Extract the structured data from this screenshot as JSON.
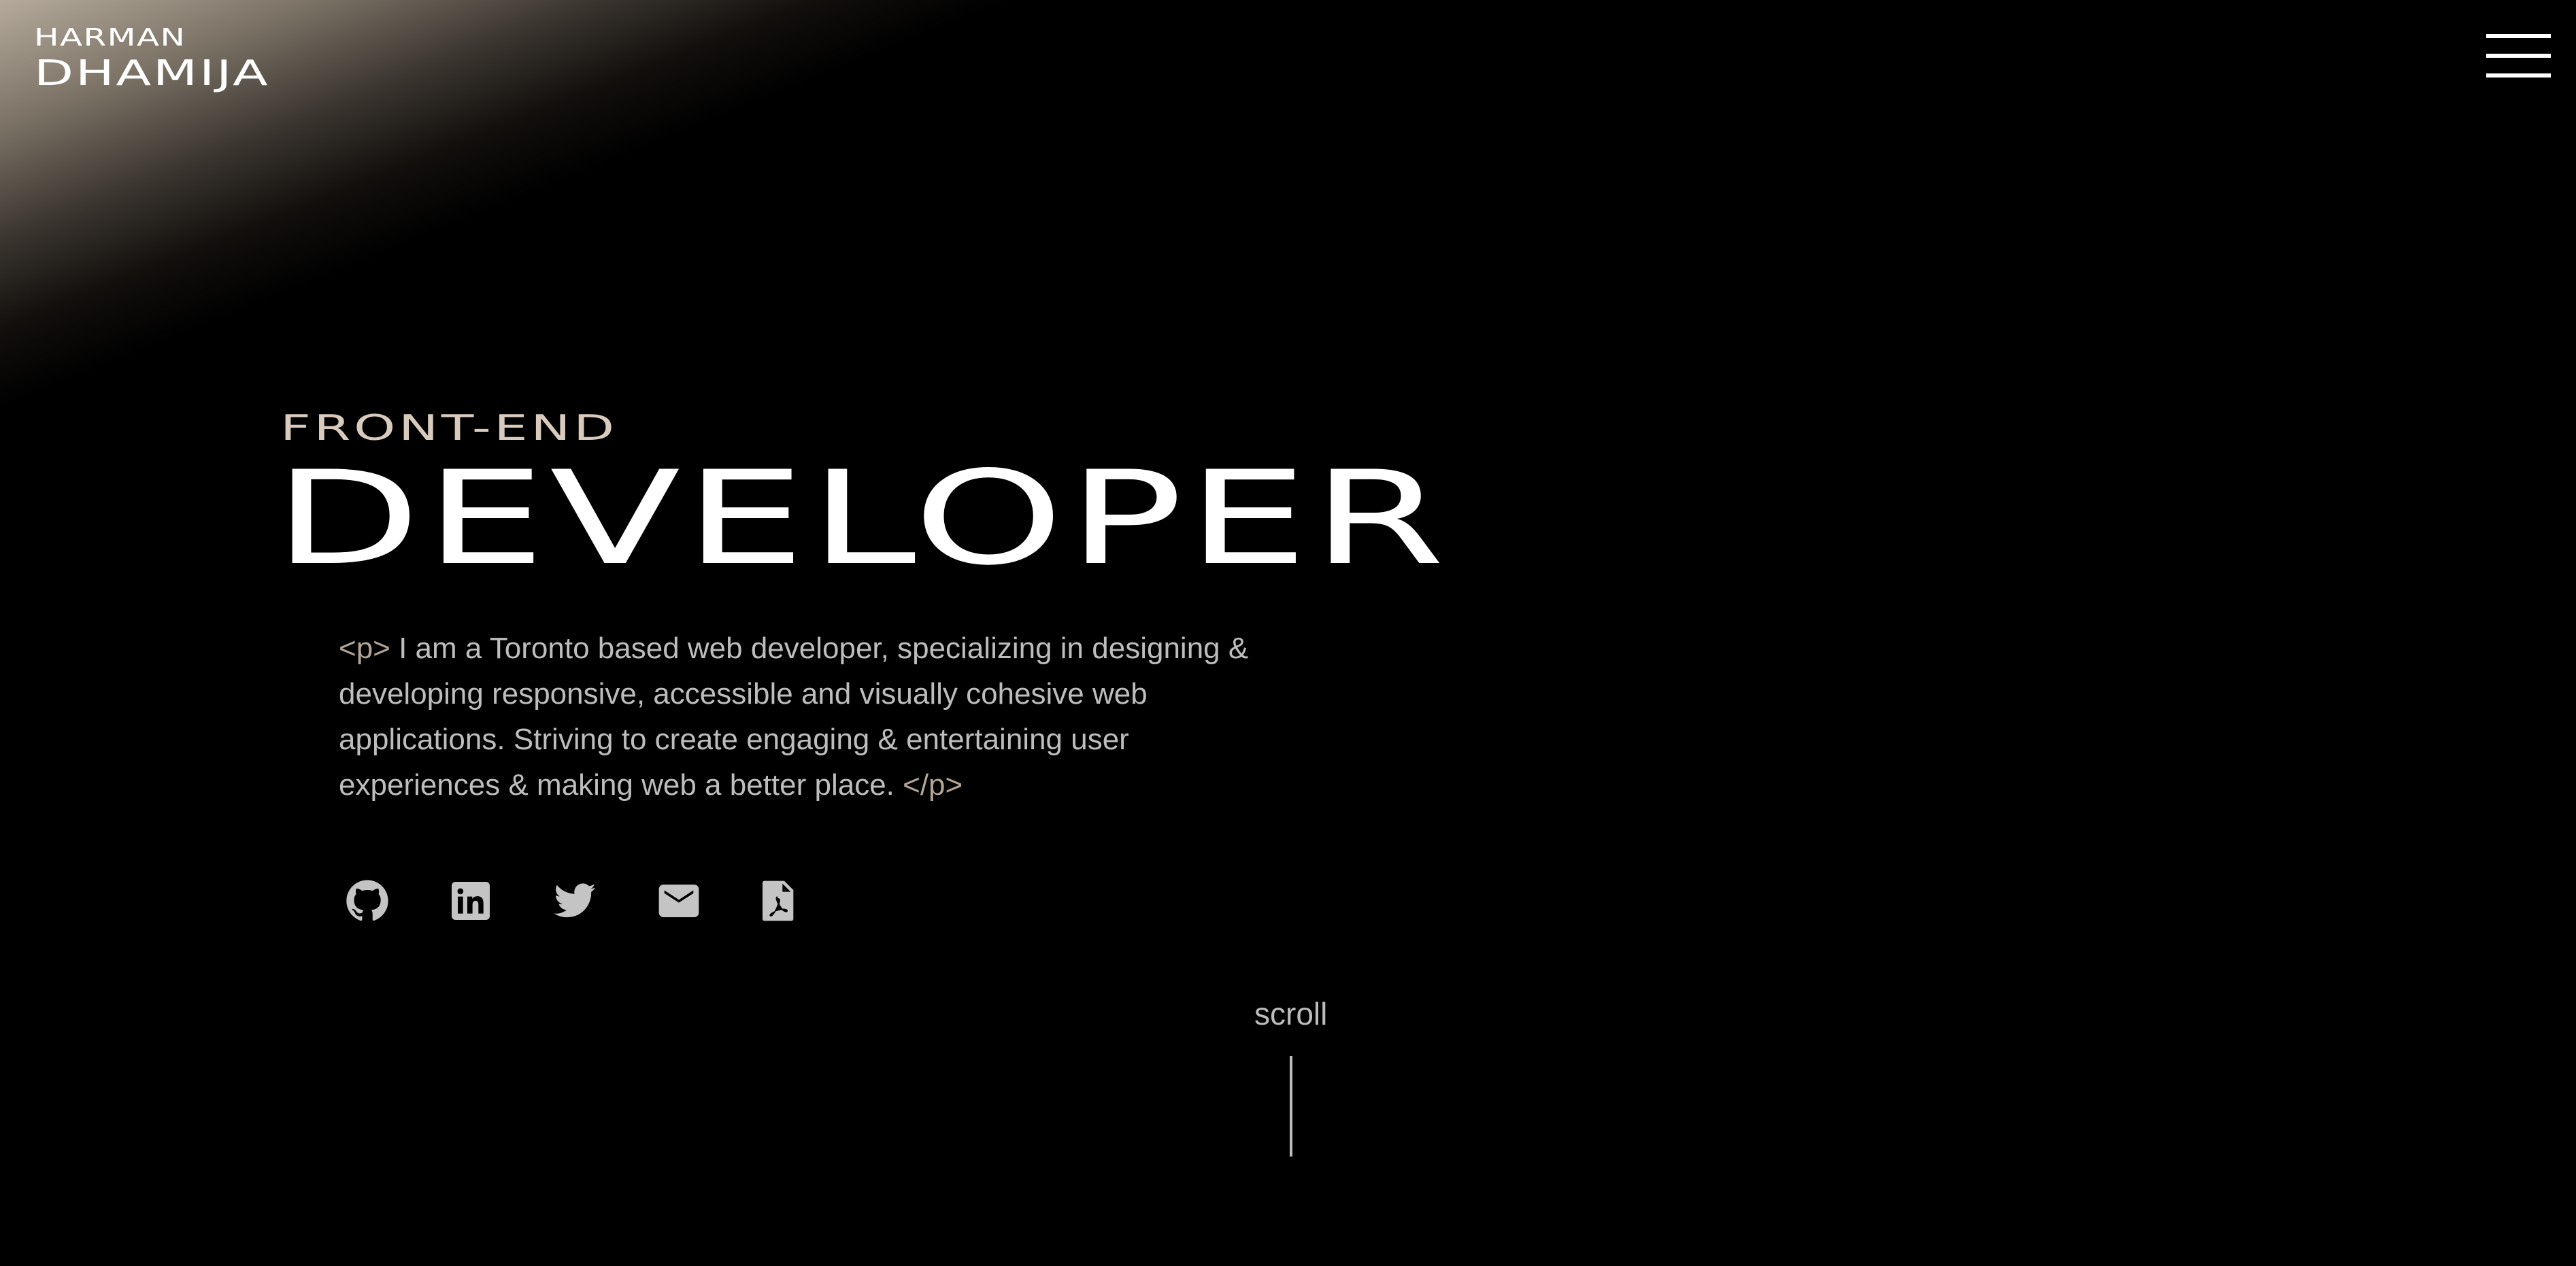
{
  "brand": {
    "first_name": "HARMAN",
    "last_name": "DHAMIJA"
  },
  "header": {
    "menu_icon": "hamburger-menu-icon"
  },
  "hero": {
    "subtitle": "FRONT-END",
    "title": "DEVELOPER",
    "bio": {
      "open_tag": "<p>",
      "text": " I am a Toronto based web developer, specializing in designing & developing responsive, accessible and visually cohesive web applications. Striving to create engaging & entertaining user experiences & making web a better place. ",
      "close_tag": "</p>"
    }
  },
  "socials": [
    {
      "icon": "github-icon"
    },
    {
      "icon": "linkedin-icon"
    },
    {
      "icon": "twitter-icon"
    },
    {
      "icon": "email-icon"
    },
    {
      "icon": "pdf-resume-icon"
    }
  ],
  "scroll": {
    "label": "scroll"
  },
  "colors": {
    "background": "#000000",
    "accent": "#d8cabc",
    "tag": "#b3a595",
    "body_text": "#bdbdbd",
    "icon": "#c4c4c4",
    "glow": "#b5aa9c"
  }
}
